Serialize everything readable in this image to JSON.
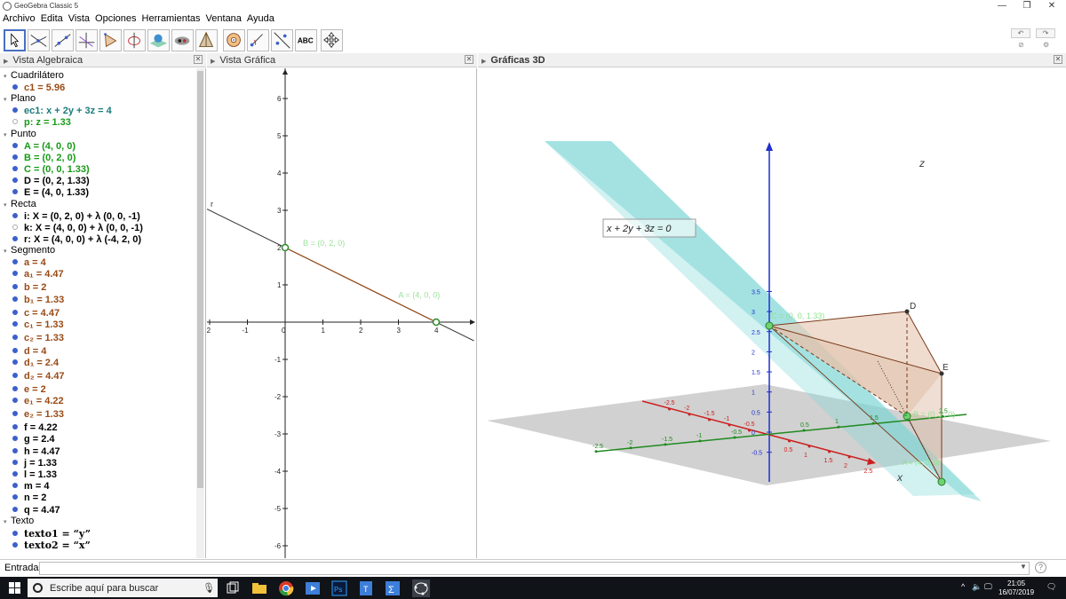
{
  "window": {
    "title": "GeoGebra Classic 5",
    "minimize": "—",
    "maximize": "❐",
    "close": "✕"
  },
  "menu": [
    "Archivo",
    "Edita",
    "Vista",
    "Opciones",
    "Herramientas",
    "Ventana",
    "Ayuda"
  ],
  "toolbar": {
    "tools": [
      "move-tool",
      "point-on-object-tool",
      "line-tool",
      "perpendicular-line-tool",
      "polygon-tool",
      "circle-tool",
      "sphere-tool",
      "intersect-surfaces-tool",
      "pyramid-tool",
      "rotate-view-tool",
      "angle-tool",
      "reflect-tool",
      "text-tool",
      "view-translate-tool"
    ],
    "text_tool_label": "ABC",
    "undo": "↶",
    "redo": "↷"
  },
  "panels": {
    "algebra": {
      "title": "Vista Algebraica"
    },
    "graphics": {
      "title": "Vista Gráfica"
    },
    "graphics3d": {
      "title": "Gráficas 3D"
    }
  },
  "algebra": {
    "groups": [
      {
        "label": "Cuadrilátero",
        "items": [
          {
            "text": "c1 = 5.96",
            "color": "brown",
            "visible": true
          }
        ]
      },
      {
        "label": "Plano",
        "items": [
          {
            "text": "ec1: x + 2y + 3z = 4",
            "color": "teal",
            "visible": true
          },
          {
            "text": "p: z = 1.33",
            "color": "green",
            "visible": false
          }
        ]
      },
      {
        "label": "Punto",
        "items": [
          {
            "text": "A = (4, 0, 0)",
            "color": "green",
            "visible": true
          },
          {
            "text": "B = (0, 2, 0)",
            "color": "green",
            "visible": true
          },
          {
            "text": "C = (0, 0, 1.33)",
            "color": "green",
            "visible": true
          },
          {
            "text": "D = (0, 2, 1.33)",
            "color": "black",
            "visible": true
          },
          {
            "text": "E = (4, 0, 1.33)",
            "color": "black",
            "visible": true
          }
        ]
      },
      {
        "label": "Recta",
        "items": [
          {
            "text": "i: X = (0, 2, 0) + λ (0, 0, -1)",
            "color": "black",
            "visible": true
          },
          {
            "text": "k: X = (4, 0, 0) + λ (0, 0, -1)",
            "color": "black",
            "visible": false
          },
          {
            "text": "r: X = (4, 0, 0) + λ (-4, 2, 0)",
            "color": "black",
            "visible": true
          }
        ]
      },
      {
        "label": "Segmento",
        "items": [
          {
            "text": "a = 4",
            "color": "brown",
            "visible": true
          },
          {
            "text": "a₁ = 4.47",
            "color": "brown",
            "visible": true
          },
          {
            "text": "b = 2",
            "color": "brown",
            "visible": true
          },
          {
            "text": "b₁ = 1.33",
            "color": "brown",
            "visible": true
          },
          {
            "text": "c = 4.47",
            "color": "brown",
            "visible": true
          },
          {
            "text": "c₁ = 1.33",
            "color": "brown",
            "visible": true
          },
          {
            "text": "c₂ = 1.33",
            "color": "brown",
            "visible": true
          },
          {
            "text": "d = 4",
            "color": "brown",
            "visible": true
          },
          {
            "text": "d₁ = 2.4",
            "color": "brown",
            "visible": true
          },
          {
            "text": "d₂ = 4.47",
            "color": "brown",
            "visible": true
          },
          {
            "text": "e = 2",
            "color": "brown",
            "visible": true
          },
          {
            "text": "e₁ = 4.22",
            "color": "brown",
            "visible": true
          },
          {
            "text": "e₂ = 1.33",
            "color": "brown",
            "visible": true
          },
          {
            "text": "f = 4.22",
            "color": "black",
            "visible": true
          },
          {
            "text": "g = 2.4",
            "color": "black",
            "visible": true
          },
          {
            "text": "h = 4.47",
            "color": "black",
            "visible": true
          },
          {
            "text": "j = 1.33",
            "color": "black",
            "visible": true
          },
          {
            "text": "l = 1.33",
            "color": "black",
            "visible": true
          },
          {
            "text": "m = 4",
            "color": "black",
            "visible": true
          },
          {
            "text": "n = 2",
            "color": "black",
            "visible": true
          },
          {
            "text": "q = 4.47",
            "color": "black",
            "visible": true
          }
        ]
      },
      {
        "label": "Texto",
        "items": [
          {
            "text": "texto1 = “y”",
            "color": "serif",
            "visible": true
          },
          {
            "text": "texto2 = “x”",
            "color": "serif",
            "visible": true
          }
        ]
      }
    ]
  },
  "graphics2d": {
    "x_ticks": [
      "-2",
      "-1",
      "0",
      "1",
      "2",
      "3",
      "4"
    ],
    "y_ticks": [
      "6",
      "5",
      "4",
      "3",
      "2",
      "1",
      "-1",
      "-2",
      "-3",
      "-4",
      "-5",
      "-6"
    ],
    "line_label": "r",
    "point_B_label": "B = (0, 2, 0)",
    "point_A_label": "A = (4, 0, 0)"
  },
  "graphics3d": {
    "z_ticks": [
      "3.5",
      "3",
      "2.5",
      "2",
      "1.5",
      "1",
      "0.5",
      "0",
      "-0.5"
    ],
    "x_ticks": [
      "-2.5",
      "-2",
      "-1.5",
      "-1",
      "-0.5",
      "0.5",
      "1",
      "1.5",
      "2",
      "2.5"
    ],
    "y_ticks": [
      "-2.5",
      "-2",
      "-1.5",
      "-1",
      "-0.5",
      "0.5",
      "1",
      "1.5",
      "2",
      "2.5"
    ],
    "equation_label": "x + 2y + 3z = 0",
    "z_label": "z",
    "x_label": "x",
    "point_D": "D",
    "point_E": "E",
    "point_C_label": "C = (0, 0, 1.33)",
    "point_B_label": "B = (0, 2, 0)",
    "point_A_label": "A = (4, 0, 0)",
    "colors": {
      "plane": "#7fd6d6",
      "xy_plane": "#9a9a9a",
      "x_axis": "#cc1f1f",
      "y_axis": "#1f8a1f",
      "z_axis": "#1f2fd0",
      "pyramid": "#e8cdbb"
    }
  },
  "input": {
    "label": "Entrada:",
    "value": "",
    "help": "?"
  },
  "taskbar": {
    "search_placeholder": "Escribe aquí para buscar",
    "time": "21:05",
    "date": "16/07/2019"
  }
}
